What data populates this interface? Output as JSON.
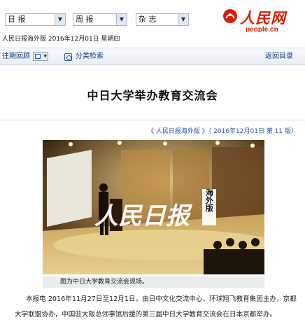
{
  "header": {
    "selects": [
      {
        "value": "日 报"
      },
      {
        "value": "周 报"
      },
      {
        "value": "杂 志"
      }
    ],
    "logo": {
      "text": "人民网",
      "url": "people.cn"
    }
  },
  "datebar": {
    "text": "人民日报海外版  2016年12月01日  星期四"
  },
  "nav": {
    "past_issues": "往期回顾",
    "category_search": "分类检索",
    "back_to_contents": "返回目录"
  },
  "article": {
    "title": "中日大学举办教育交流会",
    "source": "《 人民日报海外版 》（ 2016年12月01日   第 11 版）",
    "photo_caption": "图为中日大学教育交流会现场。",
    "watermark": "人民日报",
    "watermark_box": "海外版",
    "body": "本报电   2016年11月27日至12月1日，由日中文化交流中心、环球翔飞教育集团主办，京都大学联盟协办，中国驻大阪总领事馆后援的第三届中日大学教育交流会在日本京都举办。"
  },
  "colors": {
    "brand_red": "#d81e06",
    "link_blue": "#2a56a8",
    "nav_text": "#1a3d7a"
  }
}
